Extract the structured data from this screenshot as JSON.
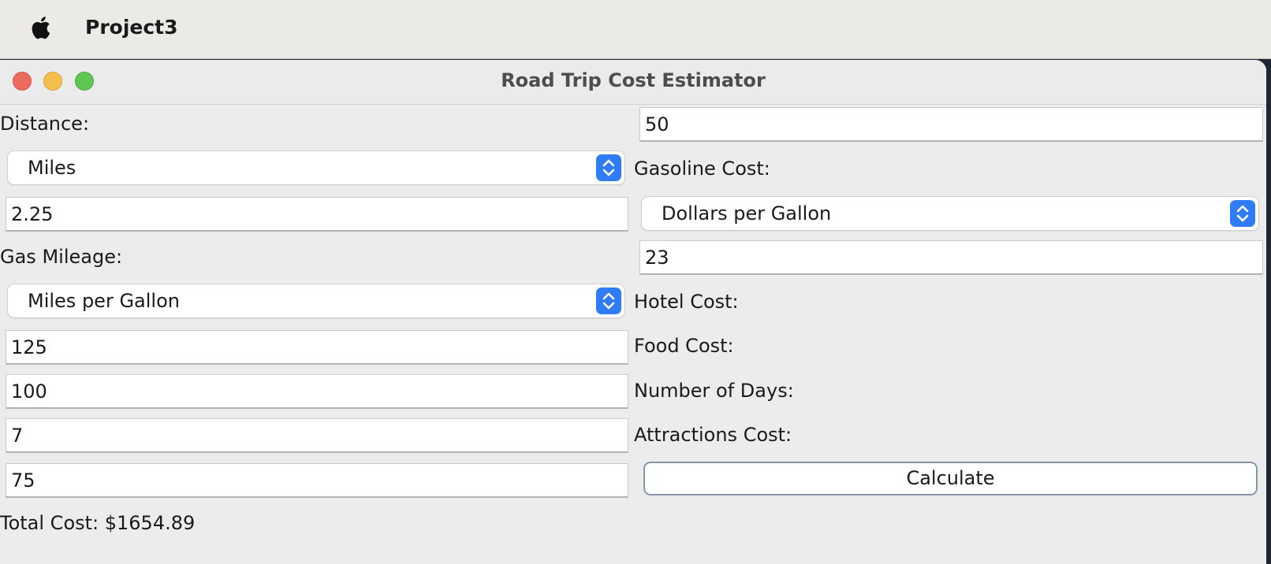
{
  "menubar": {
    "app_name": "Project3"
  },
  "window": {
    "title": "Road Trip Cost Estimator"
  },
  "form": {
    "distance_label": "Distance:",
    "distance_value": "50",
    "distance_unit": "Miles",
    "gasoline_cost_label": "Gasoline Cost:",
    "gasoline_cost_value": "2.25",
    "gasoline_cost_unit": "Dollars per Gallon",
    "gas_mileage_label": "Gas Mileage:",
    "gas_mileage_value": "23",
    "gas_mileage_unit": "Miles per Gallon",
    "hotel_cost_label": "Hotel Cost:",
    "hotel_cost_value": "125",
    "food_cost_label": "Food Cost:",
    "food_cost_value": "100",
    "days_label": "Number of Days:",
    "days_value": "7",
    "attractions_cost_label": "Attractions Cost:",
    "attractions_cost_value": "75",
    "calculate_label": "Calculate",
    "total_cost_text": "Total Cost: $1654.89"
  },
  "colors": {
    "accent": "#2f7cf6",
    "traffic_close": "#ed6a5e",
    "traffic_minimize": "#f5bf4f",
    "traffic_zoom": "#61c554"
  },
  "icons": {
    "menubar_logo": "apple-icon",
    "combo_arrow": "up-down-chevron-icon"
  }
}
